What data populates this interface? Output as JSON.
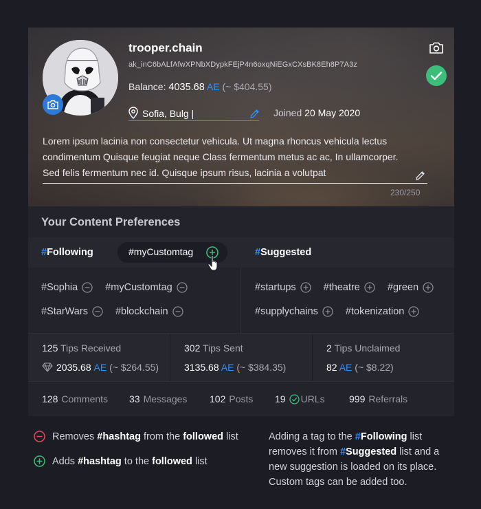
{
  "profile": {
    "username": "trooper.chain",
    "address": "ak_inC6bALfAfwXPNbXDypkFEjP4n6oxqNiEGxCXsBK8Eh8P7A3z",
    "balance_label": "Balance:",
    "balance_value": "4035.68",
    "currency": "AE",
    "balance_fiat": "(~ $404.55)",
    "location": "Sofia, Bulg",
    "joined_label": "Joined",
    "joined_date": "20 May 2020",
    "bio": "Lorem ipsum lacinia non consectetur vehicula. Ut magna rhoncus vehicula lectus condimentum Quisque feugiat neque Class fermentum metus ac ac, In ullamcorper. Sed felis fermentum nec id. Quisque ipsum risus, lacinia a volutpat",
    "bio_counter": "230/250"
  },
  "preferences": {
    "title": "Your Content Preferences",
    "hash_symbol": "#",
    "following_label": "Following",
    "suggested_label": "Suggested",
    "custom_tag_input": "#myCustomtag",
    "following_tags": [
      "#Sophia",
      "#myCustomtag",
      "#StarWars",
      "#blockchain"
    ],
    "suggested_tags": [
      "#startups",
      "#theatre",
      "#green",
      "#supplychains",
      "#tokenization"
    ]
  },
  "stats": {
    "tips_received_count": "125",
    "tips_received_label": "Tips Received",
    "tips_received_amount": "2035.68",
    "tips_received_fiat": "(~ $264.55)",
    "tips_sent_count": "302",
    "tips_sent_label": "Tips Sent",
    "tips_sent_amount": "3135.68",
    "tips_sent_fiat": "(~ $384.35)",
    "tips_unclaimed_count": "2",
    "tips_unclaimed_label": "Tips Unclaimed",
    "tips_unclaimed_amount": "82",
    "tips_unclaimed_fiat": "(~ $8.22)",
    "currency": "AE"
  },
  "counts": {
    "comments_count": "128",
    "comments_label": "Comments",
    "messages_count": "33",
    "messages_label": "Messages",
    "posts_count": "102",
    "posts_label": "Posts",
    "urls_count": "19",
    "urls_label": "URLs",
    "referrals_count": "999",
    "referrals_label": "Referrals"
  },
  "legend": {
    "remove_pre": "Removes",
    "remove_tag": "#hashtag",
    "remove_mid": "from the",
    "remove_bold": "followed",
    "remove_post": "list",
    "add_pre": "Adds",
    "add_tag": "#hashtag",
    "add_mid": "to the",
    "add_bold": "followed",
    "add_post": "list"
  },
  "note": {
    "p1": "Adding a tag to the",
    "hash": "#",
    "following": "Following",
    "p2": "list removes it from",
    "suggested": "Suggested",
    "p3": "list and a new suggestion is loaded on its place. Custom tags can be added too."
  },
  "colors": {
    "accent": "#2f8fff",
    "add": "#3cbd7a",
    "remove": "#e04a5a",
    "background": "#1c1c24",
    "panel": "#272730"
  }
}
